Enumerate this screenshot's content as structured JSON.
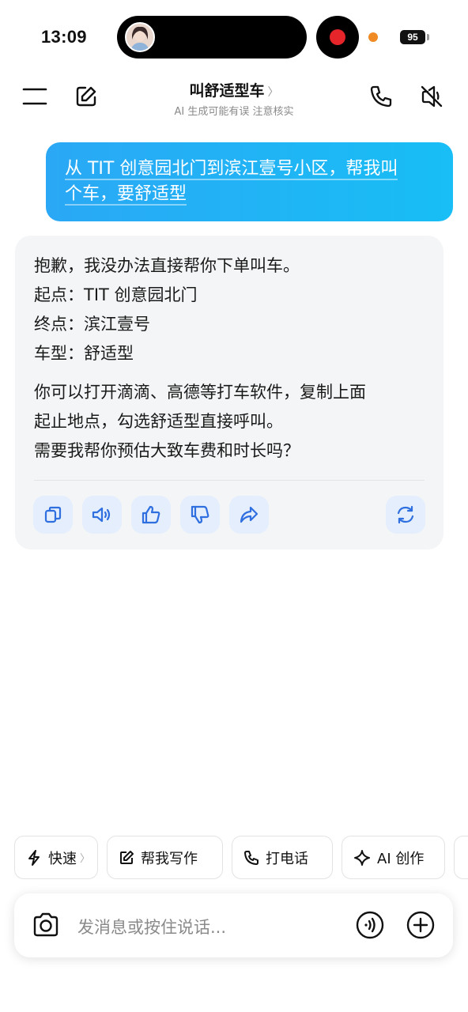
{
  "status_bar": {
    "time": "13:09",
    "battery": "95"
  },
  "header": {
    "title": "叫舒适型车",
    "title_chevron": "〉",
    "subtitle": "AI 生成可能有误 注意核实"
  },
  "user_message": {
    "line1": "从 TIT 创意园北门到滨江壹号小区，帮我叫",
    "line2": "个车，要舒适型"
  },
  "ai_message": {
    "lines_top": [
      "抱歉，我没办法直接帮你下单叫车。",
      "起点：TIT 创意园北门",
      "终点：滨江壹号",
      "车型：舒适型"
    ],
    "lines_bottom": [
      "你可以打开滴滴、高德等打车软件，复制上面",
      "起止地点，勾选舒适型直接呼叫。",
      "需要我帮你预估大致车费和时长吗？"
    ],
    "actions": [
      "copy-icon",
      "speaker-icon",
      "thumbs-up-icon",
      "thumbs-down-icon",
      "share-icon",
      "regenerate-icon"
    ]
  },
  "quick_chips": [
    {
      "label": "快速",
      "icon": "lightning-icon",
      "chevron": "〉"
    },
    {
      "label": "帮我写作",
      "icon": "edit-icon"
    },
    {
      "label": "打电话",
      "icon": "phone-icon"
    },
    {
      "label": "AI 创作",
      "icon": "sparkle-icon"
    }
  ],
  "input": {
    "placeholder": "发消息或按住说话..."
  },
  "colors": {
    "accent": "#1bb6f5",
    "action_bg": "#e4eefc",
    "action_icon": "#2f6fe0"
  }
}
